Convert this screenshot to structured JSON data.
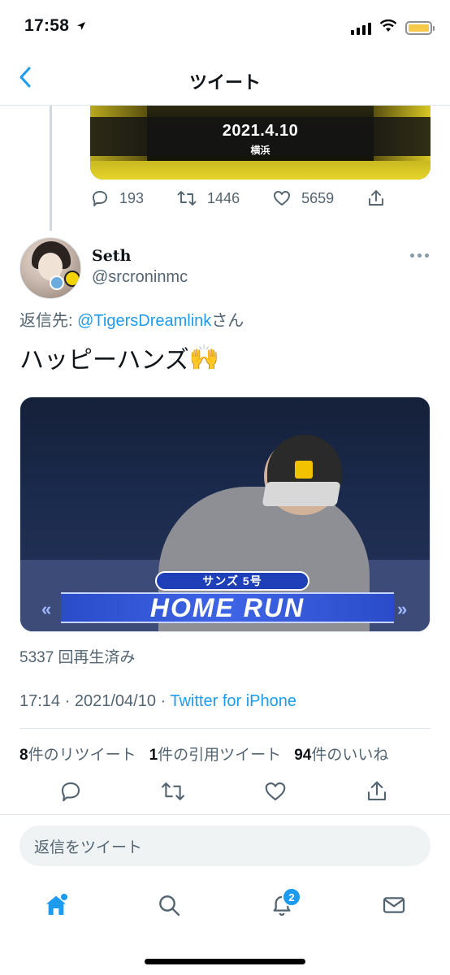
{
  "status_bar": {
    "time": "17:58",
    "battery_color": "#f7c948"
  },
  "nav": {
    "title": "ツイート"
  },
  "previous_tweet": {
    "media": {
      "date_text": "2021.4.10",
      "place_text": "横浜"
    },
    "actions": {
      "replies": "193",
      "retweets": "1446",
      "likes": "5659"
    }
  },
  "tweet": {
    "display_name": "Seth",
    "handle": "@srcroninmc",
    "reply_prefix": "返信先: ",
    "reply_mention": "@TigersDreamlink",
    "reply_suffix": "さん",
    "text": "ハッピーハンズ",
    "emoji": "🙌",
    "video": {
      "sub_label": "サンズ 5号",
      "banner": "HOME RUN"
    },
    "view_count": "5337 回再生済み",
    "time": "17:14",
    "date": "2021/04/10",
    "separator": " · ",
    "source": "Twitter for iPhone",
    "stats": {
      "retweets_count": "8",
      "retweets_label": "件のリツイート",
      "quotes_count": "1",
      "quotes_label": "件の引用ツイート",
      "likes_count": "94",
      "likes_label": "件のいいね"
    }
  },
  "reply_box": {
    "placeholder": "返信をツイート"
  },
  "tab_bar": {
    "notifications_badge": "2"
  },
  "colors": {
    "accent": "#1d9bf0",
    "muted": "#536471"
  }
}
